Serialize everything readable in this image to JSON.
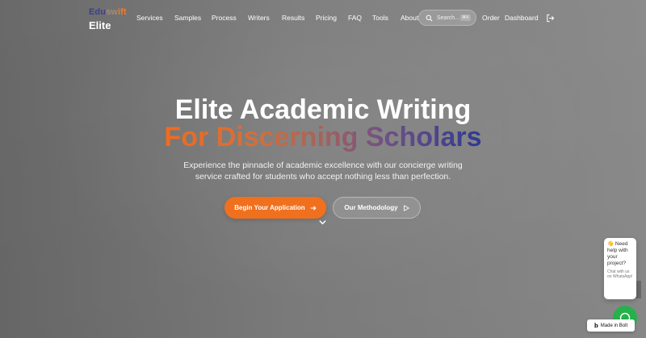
{
  "header": {
    "logo_top_parts": [
      "Edu",
      "sw",
      "ift"
    ],
    "logo_bottom": "Elite",
    "nav": [
      "Services",
      "Samples",
      "Process",
      "Writers",
      "Results",
      "Pricing",
      "FAQ",
      "Tools",
      "About"
    ],
    "search_placeholder": "Search...",
    "search_shortcut": "⌘K",
    "order": "Order",
    "dashboard": "Dashboard",
    "icons": [
      "search-icon",
      "logout-icon"
    ]
  },
  "hero": {
    "title_line1": "Elite Academic Writing",
    "title_line2": "For Discerning Scholars",
    "subtitle": "Experience the pinnacle of academic excellence with our concierge writing service crafted for students who accept nothing less than perfection.",
    "primary_cta": "Begin Your Application",
    "secondary_cta": "Our Methodology",
    "colors": {
      "accent": "#f0701e",
      "gradient_end": "#2e3a92"
    },
    "icons": [
      "arrow-right-icon",
      "play-icon",
      "chevron-down-icon"
    ]
  },
  "chat": {
    "title": "👋 Need help with your project?",
    "subtitle": "Chat with us on WhatsApp!",
    "icon": "whatsapp-icon"
  },
  "badge": {
    "mark": "b",
    "label": "Made in Bolt"
  }
}
